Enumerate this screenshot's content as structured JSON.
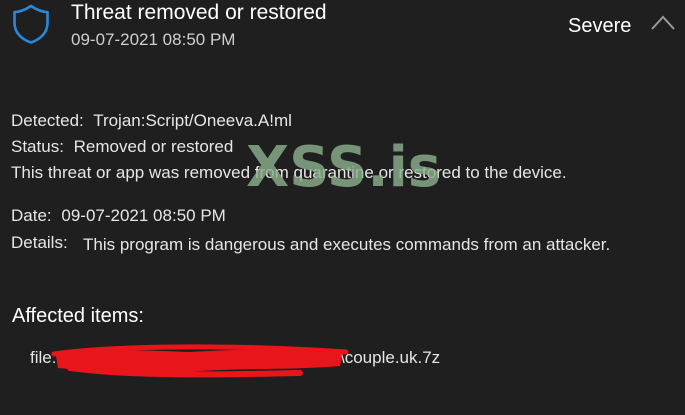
{
  "header": {
    "icon": "shield-icon",
    "title": "Threat removed or restored",
    "timestamp": "09-07-2021 08:50 PM",
    "severity": "Severe",
    "collapse_icon": "chevron-up-icon",
    "accent_color": "#2b88d8"
  },
  "detail": {
    "detected_label": "Detected:",
    "detected_value": "Trojan:Script/Oneeva.A!ml",
    "status_label": "Status:",
    "status_value": "Removed or restored",
    "description": "This threat or app was removed from quarantine or restored to the device.",
    "date_label": "Date:",
    "date_value": "09-07-2021 08:50 PM",
    "details_label": "Details:",
    "details_value": "This program is dangerous and executes commands from an attacker."
  },
  "affected": {
    "heading": "Affected items:",
    "file_prefix": "file:",
    "file_suffix": "\\couple.uk.7z",
    "redaction_color": "#e8161b"
  },
  "watermark": {
    "text": "XSS.is",
    "color": "#8caf8c"
  }
}
